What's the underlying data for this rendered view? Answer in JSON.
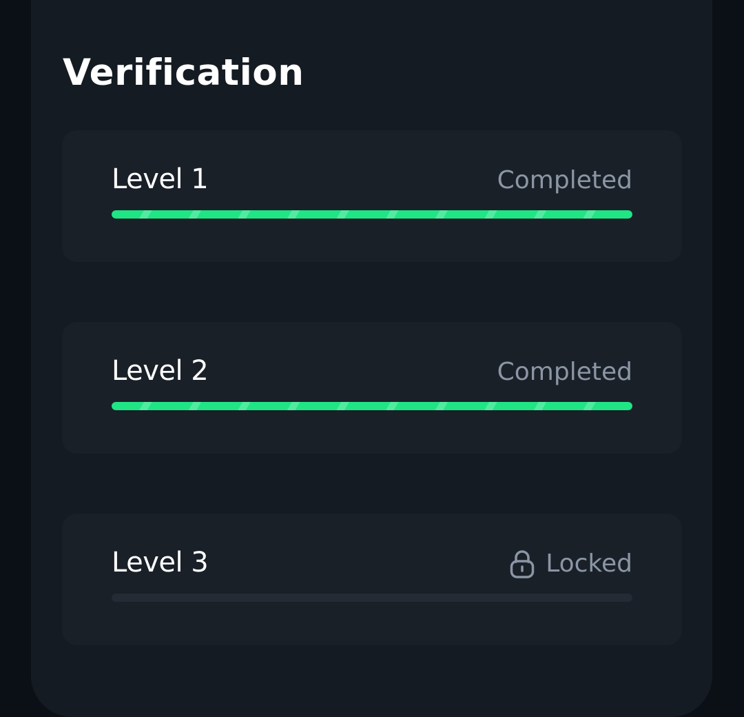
{
  "section": {
    "title": "Verification"
  },
  "levels": [
    {
      "label": "Level 1",
      "status": "Completed",
      "progress": 1.0
    },
    {
      "label": "Level 2",
      "status": "Completed",
      "progress": 1.0
    },
    {
      "label": "Level 3",
      "status": "Locked",
      "progress": 0.0,
      "icon": "lock-icon"
    }
  ],
  "colors": {
    "background": "#0b1016",
    "panel": "#151b22",
    "card": "#1a2028",
    "progress_fill": "#1fe585",
    "progress_track": "#242b34",
    "status_text": "#8b96a5",
    "title_text": "#ffffff"
  }
}
